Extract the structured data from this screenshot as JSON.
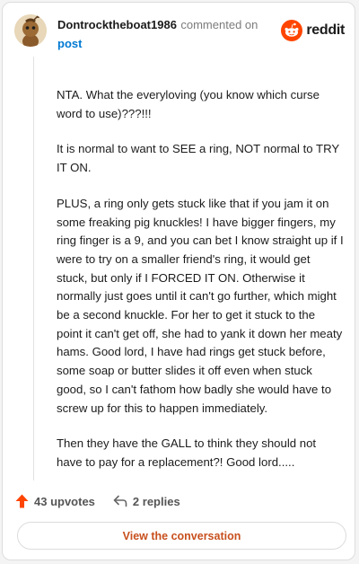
{
  "comment": {
    "username": "Dontrocktheboat1986",
    "action_text": "commented on",
    "post_link": "post",
    "brand": "reddit",
    "paragraphs": [
      "NTA. What the everyloving (you know which curse word to use)???!!!",
      "It is normal to want to SEE a ring, NOT normal to TRY IT ON.",
      "PLUS, a ring only gets stuck like that if you jam it on some freaking pig knuckles! I have bigger fingers, my ring finger is a 9, and you can bet I know straight up if I were to try on a smaller friend's ring, it would get stuck, but only if I FORCED IT ON. Otherwise it normally just goes until it can't go further, which might be a second knuckle. For her to get it stuck to the point it can't get off, she had to yank it down her meaty hams. Good lord, I have had rings get stuck before, some soap or butter slides it off even when stuck good, so I can't fathom how badly she would have to screw up for this to happen immediately.",
      "Then they have the GALL to think they should not have to pay for a replacement?! Good lord....."
    ],
    "upvotes": "43 upvotes",
    "replies": "2 replies",
    "view_button": "View the conversation"
  },
  "icons": {
    "avatar": "snoo-avatar",
    "brand": "reddit-logo-icon",
    "upvote": "upvote-arrow-icon",
    "reply": "reply-arrow-icon"
  },
  "colors": {
    "upvote": "#ff4500",
    "link": "#0079d3",
    "button_text": "#c8501e",
    "brand_icon": "#ff4500"
  }
}
